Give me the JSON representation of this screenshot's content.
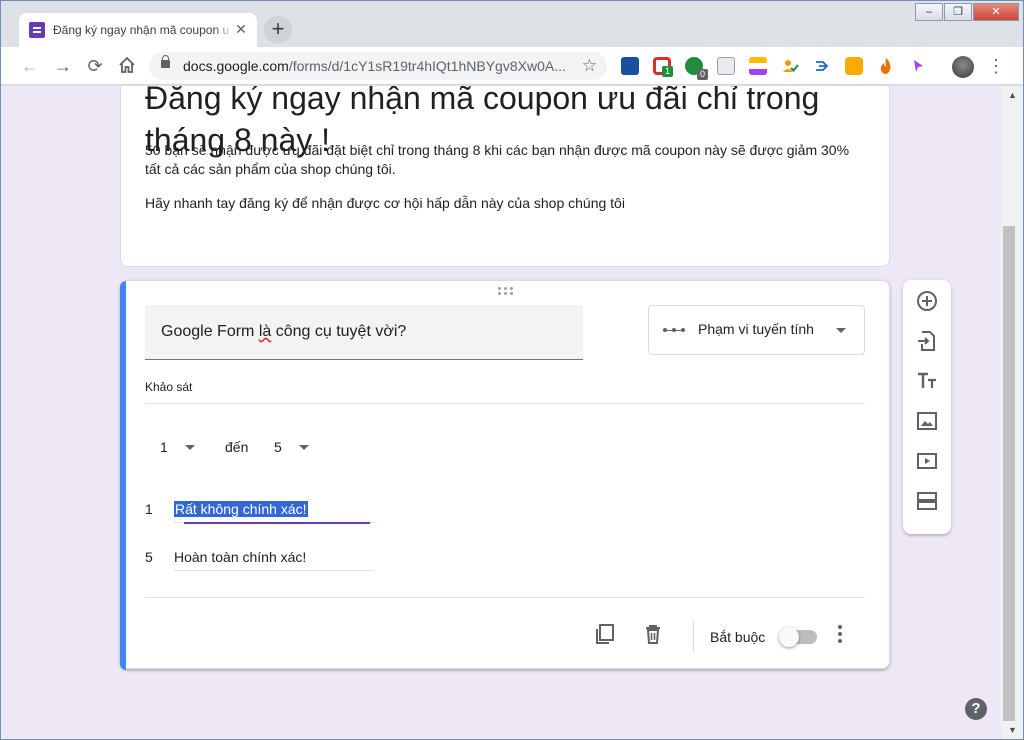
{
  "browser": {
    "tab_title": "Đăng ký ngay nhận mã coupon ư",
    "tab_close": "✕",
    "new_tab": "+",
    "url_host": "docs.google.com",
    "url_path": "/forms/d/1cY1sR19tr4hIQt1hNBYgv8Xw0A...",
    "ext_badges": [
      "1",
      "0"
    ],
    "window_controls": [
      "–",
      "❐",
      "✕"
    ]
  },
  "form": {
    "title": "Đăng ký ngay nhận mã coupon ưu đãi chỉ trong tháng 8 này !",
    "description": "50 bạn sẽ nhận được ưu đãi đặt biệt chỉ trong tháng 8 khi các bạn nhận được mã coupon này sẽ được giảm 30% tất cả các sản phẩm của shop chúng tôi.",
    "description2": "Hãy nhanh tay đăng ký để nhận được cơ hội hấp dẫn này của shop chúng tôi"
  },
  "question": {
    "text_before": "Google Form ",
    "text_spell": "là",
    "text_after": " công cụ tuyệt vời?",
    "type_label": "Phạm vi tuyến tính",
    "section_label": "Khảo sát",
    "range_from": "1",
    "range_sep": "đến",
    "range_to": "5",
    "low_num": "1",
    "low_label": "Rất không chính xác!",
    "high_num": "5",
    "high_label": "Hoàn toàn chính xác!",
    "required_label": "Bắt buộc",
    "required_on": false
  },
  "icons": {
    "help": "?"
  },
  "colors": {
    "accent": "#4285f4",
    "purple": "#673ab7",
    "background": "#ede7f6"
  }
}
